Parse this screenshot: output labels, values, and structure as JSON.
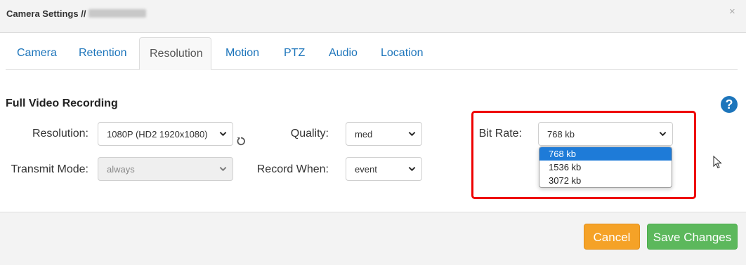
{
  "header": {
    "title": "Camera Settings //",
    "close_label": "×"
  },
  "tabs": [
    {
      "label": "Camera",
      "active": false
    },
    {
      "label": "Retention",
      "active": false
    },
    {
      "label": "Resolution",
      "active": true
    },
    {
      "label": "Motion",
      "active": false
    },
    {
      "label": "PTZ",
      "active": false
    },
    {
      "label": "Audio",
      "active": false
    },
    {
      "label": "Location",
      "active": false
    }
  ],
  "section": {
    "title": "Full Video Recording",
    "help_label": "?"
  },
  "fields": {
    "resolution": {
      "label": "Resolution:",
      "value": "1080P (HD2 1920x1080)"
    },
    "transmit_mode": {
      "label": "Transmit Mode:",
      "value": "always",
      "disabled": true
    },
    "quality": {
      "label": "Quality:",
      "value": "med"
    },
    "record_when": {
      "label": "Record When:",
      "value": "event"
    },
    "bit_rate": {
      "label": "Bit Rate:",
      "value": "768 kb",
      "options": [
        "768 kb",
        "1536 kb",
        "3072 kb"
      ]
    }
  },
  "footer": {
    "cancel_label": "Cancel",
    "save_label": "Save Changes"
  },
  "colors": {
    "accent": "#1d75bb",
    "cancel": "#f5a227",
    "save": "#5cb85c",
    "highlight": "#ee0000",
    "selected_option": "#1e7bd8"
  }
}
